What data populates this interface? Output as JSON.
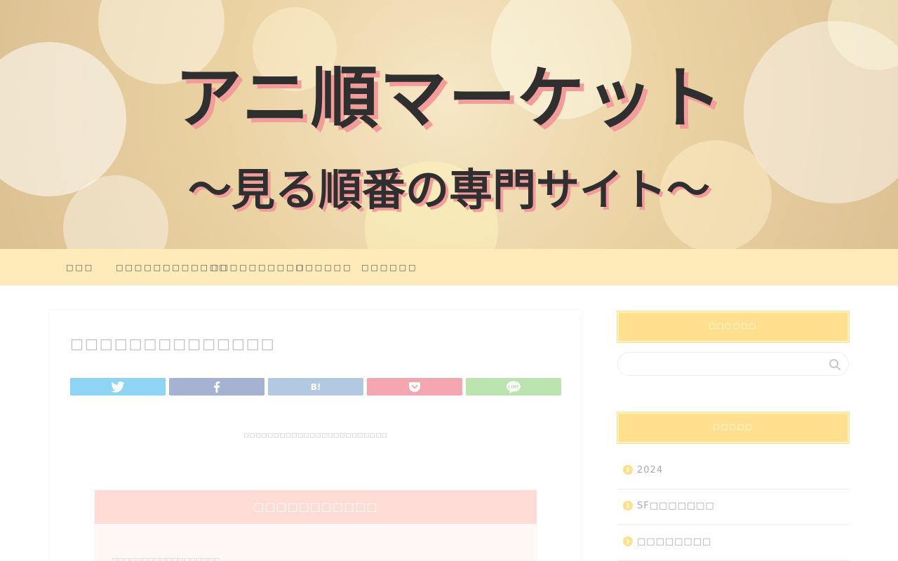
{
  "header": {
    "logo_line1": "アニ順マーケット",
    "logo_line2": "〜見る順番の専門サイト〜"
  },
  "nav": {
    "items": [
      {
        "label": "□□□"
      },
      {
        "label": "□□□□□□□□□□□□"
      },
      {
        "label": "□□□□□□□□□□"
      },
      {
        "label": "□□□□□□"
      },
      {
        "label": "□□□□□□"
      }
    ]
  },
  "post": {
    "title": "□□□□□□□□□□□□□□",
    "share_buttons": [
      {
        "name": "twitter",
        "label": "",
        "color": "#8fd3f5"
      },
      {
        "name": "facebook",
        "label": "",
        "color": "#a6b2d2"
      },
      {
        "name": "hatena",
        "label": "B!",
        "color": "#b3c9e2"
      },
      {
        "name": "pocket",
        "label": "",
        "color": "#f5a6b1"
      },
      {
        "name": "line",
        "label": "",
        "color": "#bbe4b0"
      }
    ],
    "notice": "□□□□□□□□□□□□□□□□□□□□□□□□",
    "toc_title": "□□□□□□□□□□□",
    "toc_line": "□□□□□□□□□□□□□□□□□□"
  },
  "sidebar": {
    "search_title": "□□□□□□",
    "categories_title": "□□□□□",
    "categories": [
      {
        "label": "2024"
      },
      {
        "label": "SF□□□□□□□"
      },
      {
        "label": "□□□□□□□□"
      }
    ]
  },
  "colors": {
    "nav_bg": "#ffeab9",
    "widget_title_bg": "#ffe08e",
    "toc_head_bg": "#ffdcd6"
  }
}
